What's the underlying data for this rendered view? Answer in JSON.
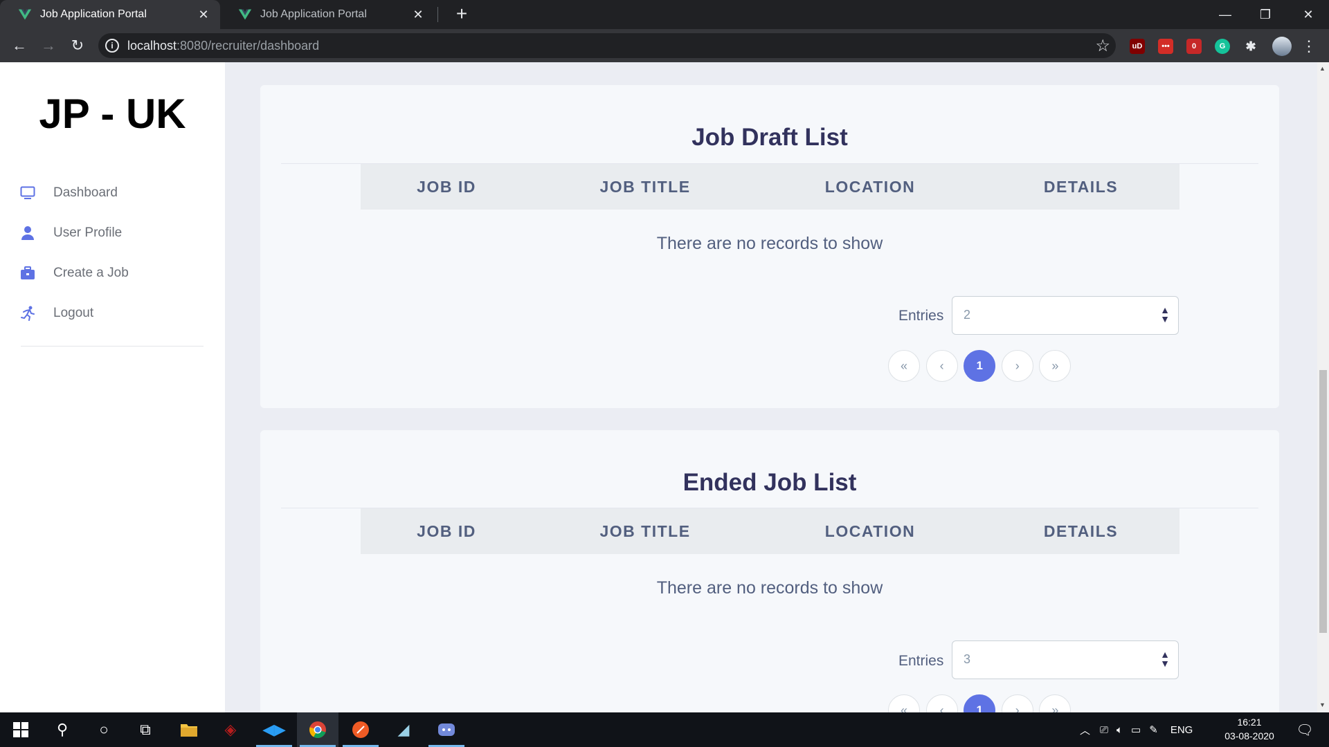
{
  "browser": {
    "tabs": [
      {
        "title": "Job Application Portal",
        "active": true
      },
      {
        "title": "Job Application Portal",
        "active": false
      }
    ],
    "url_host": "localhost",
    "url_path": ":8080/recruiter/dashboard",
    "extensions": [
      {
        "name": "ublock-origin",
        "label": "uD",
        "color": "#800000"
      },
      {
        "name": "lastpass",
        "label": "•••",
        "color": "#d32d27"
      },
      {
        "name": "extension-badge",
        "label": "0",
        "color": "#c62828"
      },
      {
        "name": "grammarly",
        "label": "G",
        "color": "#15c39a"
      }
    ]
  },
  "sidebar": {
    "brand": "JP - UK",
    "items": [
      {
        "label": "Dashboard",
        "icon": "monitor-icon"
      },
      {
        "label": "User Profile",
        "icon": "user-icon"
      },
      {
        "label": "Create a Job",
        "icon": "briefcase-icon"
      },
      {
        "label": "Logout",
        "icon": "running-person-icon"
      }
    ]
  },
  "draft_card": {
    "title": "Job Draft List",
    "columns": [
      "JOB ID",
      "JOB TITLE",
      "LOCATION",
      "DETAILS"
    ],
    "empty_text": "There are no records to show",
    "entries_label": "Entries",
    "entries_value": "2",
    "pager": [
      "«",
      "‹",
      "1",
      "›",
      "»"
    ]
  },
  "ended_card": {
    "title": "Ended Job List",
    "columns": [
      "JOB ID",
      "JOB TITLE",
      "LOCATION",
      "DETAILS"
    ],
    "empty_text": "There are no records to show",
    "entries_label": "Entries",
    "entries_value": "3",
    "pager": [
      "«",
      "‹",
      "1",
      "›",
      "»"
    ]
  },
  "taskbar": {
    "language": "ENG",
    "time": "16:21",
    "date": "03-08-2020"
  },
  "colors": {
    "accent": "#5e72e4",
    "heading": "#32325d",
    "body_text": "#525f7f"
  }
}
